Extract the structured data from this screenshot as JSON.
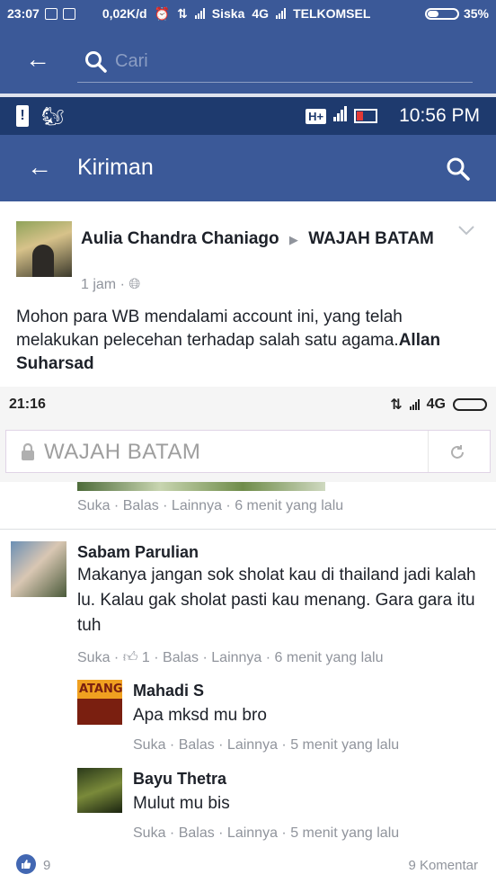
{
  "status_bar_top": {
    "time": "23:07",
    "speed": "0,02K/d",
    "carrier1": "Siska",
    "net1": "4G",
    "carrier2": "TELKOMSEL",
    "battery": "35%"
  },
  "search_bar": {
    "placeholder": "Cari"
  },
  "status_bar_inner": {
    "network": "H+",
    "time": "10:56 PM"
  },
  "nav": {
    "title": "Kiriman"
  },
  "post": {
    "author": "Aulia Chandra Chaniago",
    "target": "WAJAH BATAM",
    "time": "1 jam",
    "body_text": "Mohon para WB mendalami account ini, yang telah melakukan pelecehan terhadap salah satu agama.",
    "body_bold": "Allan Suharsad"
  },
  "status_bar_browser": {
    "time": "21:16",
    "net": "4G"
  },
  "browser": {
    "url_text": "WAJAH BATAM"
  },
  "first_actions": "Suka · Balas · Lainnya · 6 menit yang lalu",
  "comments": [
    {
      "name": "Sabam Parulian",
      "text": "Makanya jangan sok sholat kau di thailand jadi kalah lu. Kalau gak sholat pasti kau menang. Gara gara itu tuh",
      "actions_prefix": "Suka ·",
      "like_count": "1",
      "actions_suffix": "· Balas · Lainnya · 6 menit yang lalu"
    }
  ],
  "replies": [
    {
      "name": "Mahadi S",
      "text": "Apa mksd mu bro",
      "actions": "Suka · Balas · Lainnya · 5 menit yang lalu",
      "avatar_text": "ATANG"
    },
    {
      "name": "Bayu Thetra",
      "text": "Mulut mu bis",
      "actions": "Suka · Balas · Lainnya · 5 menit yang lalu"
    }
  ],
  "footer": {
    "likes": "9",
    "comments": "9 Komentar"
  },
  "colors": {
    "fb_blue": "#3b5998",
    "dark_blue": "#1e3a6e",
    "grey_text": "#90949c"
  }
}
